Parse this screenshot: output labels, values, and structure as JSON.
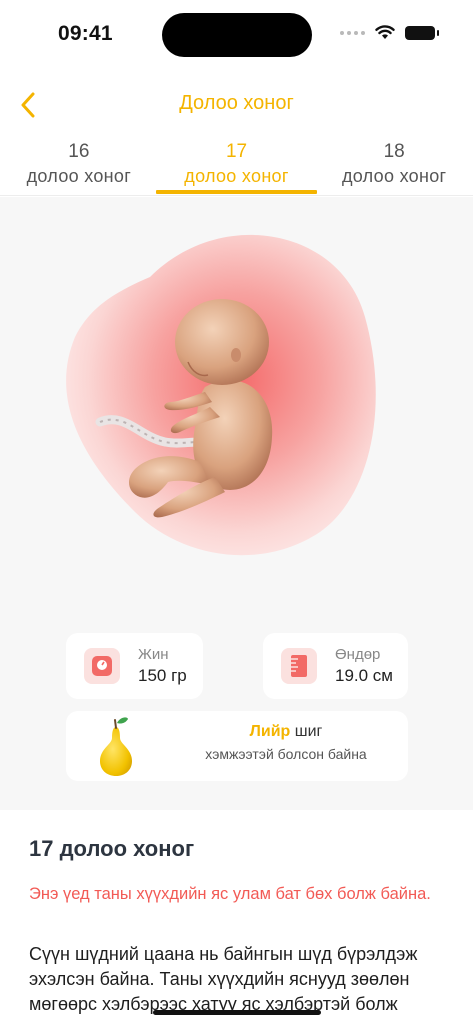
{
  "status_bar": {
    "time": "09:41"
  },
  "header": {
    "title": "Долоо хоног"
  },
  "week_tabs": [
    {
      "number": "16",
      "label": "долоо хоног"
    },
    {
      "number": "17",
      "label": "долоо хоног"
    },
    {
      "number": "18",
      "label": "долоо хоног"
    }
  ],
  "stats": {
    "weight": {
      "label": "Жин",
      "value": "150 гр"
    },
    "height": {
      "label": "Өндөр",
      "value": "19.0 см"
    }
  },
  "comparison": {
    "fruit": "Лийр",
    "suffix": " шиг",
    "line2": "хэмжээтэй болсон байна"
  },
  "article": {
    "title": "17 долоо хоног",
    "highlight": "Энэ үед таны хүүхдийн яс улам  бат бөх болж байна.",
    "body": "Сүүн шүдний цаана нь байнгын шүд бүрэлдэж эхэлсэн байна. Таны хүүхдийн яснууд зөөлөн мөгөөрс хэлбэрээс хатуу яс хэлбэртэй болж хувирдаг."
  },
  "colors": {
    "accent": "#f4b400",
    "highlight": "#f25a55",
    "icon_bg": "#fbe1df"
  }
}
